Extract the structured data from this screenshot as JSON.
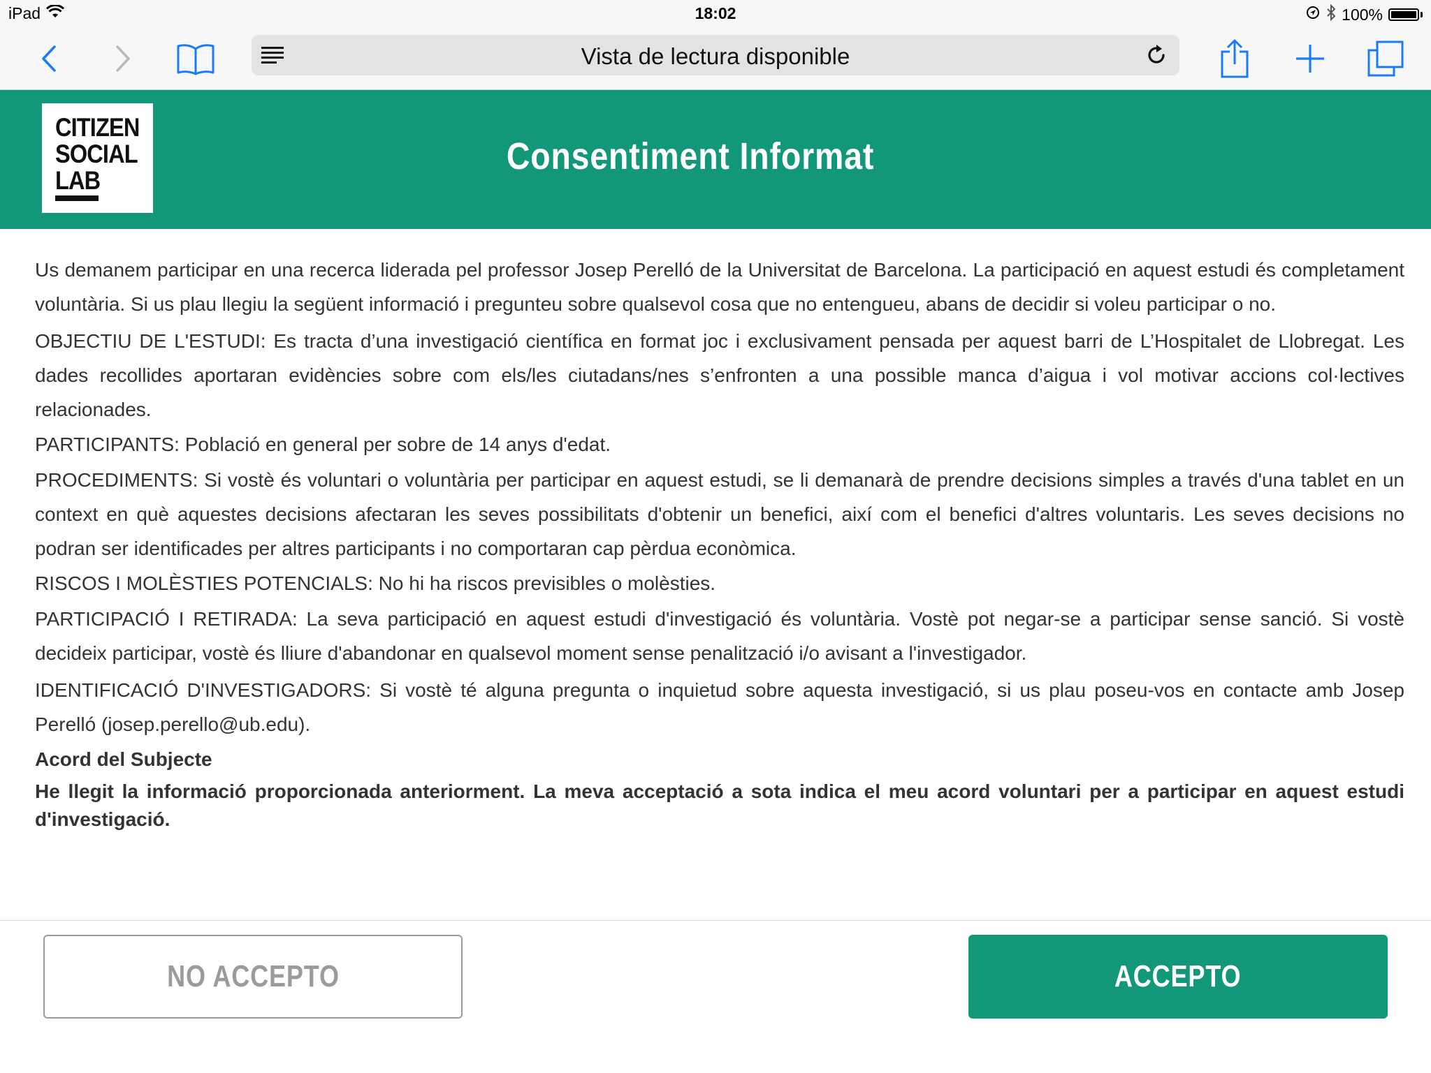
{
  "status_bar": {
    "device": "iPad",
    "time": "18:02",
    "battery": "100%"
  },
  "browser": {
    "address_text": "Vista de lectura disponible"
  },
  "header": {
    "logo_lines": [
      "CITIZEN",
      "SOCIAL",
      "LAB"
    ],
    "title": "Consentiment Informat"
  },
  "content": {
    "intro": "Us demanem participar en una recerca liderada pel professor Josep Perelló de la Universitat de Barcelona. La participació en aquest estudi és completament voluntària. Si us plau llegiu la següent informació i pregunteu sobre qualsevol cosa que no entengueu, abans de decidir si voleu participar o no.",
    "objectiu": "OBJECTIU DE L'ESTUDI: Es tracta d’una investigació científica en format joc i exclusivament pensada per aquest barri de L’Hospitalet de Llobregat. Les dades recollides aportaran evidències sobre com els/les ciutadans/nes s’enfronten a una possible manca d’aigua i vol motivar accions col·lectives relacionades.",
    "participants": "PARTICIPANTS: Població en general per sobre de 14 anys d'edat.",
    "procediments": "PROCEDIMENTS: Si vostè és voluntari o voluntària per participar en aquest estudi, se li demanarà de prendre decisions simples a través d'una tablet en un context en què aquestes decisions afectaran les seves possibilitats d'obtenir un benefici, així com el benefici d'altres voluntaris. Les seves decisions no podran ser identificades per altres participants i no comportaran cap pèrdua econòmica.",
    "riscos": "RISCOS I MOLÈSTIES POTENCIALS: No hi ha riscos previsibles o molèsties.",
    "participacio": "PARTICIPACIÓ I RETIRADA: La seva participació en aquest estudi d'investigació és voluntària. Vostè pot negar-se a participar sense sanció. Si vostè decideix participar, vostè és lliure d'abandonar en qualsevol moment sense penalització i/o avisant a l'investigador.",
    "identificacio": "IDENTIFICACIÓ D'INVESTIGADORS: Si vostè té alguna pregunta o inquietud sobre aquesta investigació, si us plau poseu-vos en contacte amb Josep Perelló (josep.perello@ub.edu).",
    "acord_title": "Acord del Subjecte",
    "acord_text": "He llegit la informació proporcionada anteriorment. La meva acceptació a sota indica el meu acord voluntari per a participar en aquest estudi d'investigació."
  },
  "footer": {
    "reject_label": "NO ACCEPTO",
    "accept_label": "ACCEPTO"
  },
  "colors": {
    "brand_green": "#129778",
    "browser_blue": "#1a7cf4"
  },
  "icons": [
    "wifi-icon",
    "location-icon",
    "bluetooth-icon",
    "battery-icon",
    "back-icon",
    "forward-icon",
    "bookmarks-icon",
    "reader-view-icon",
    "reload-icon",
    "share-icon",
    "new-tab-icon",
    "tabs-icon"
  ]
}
